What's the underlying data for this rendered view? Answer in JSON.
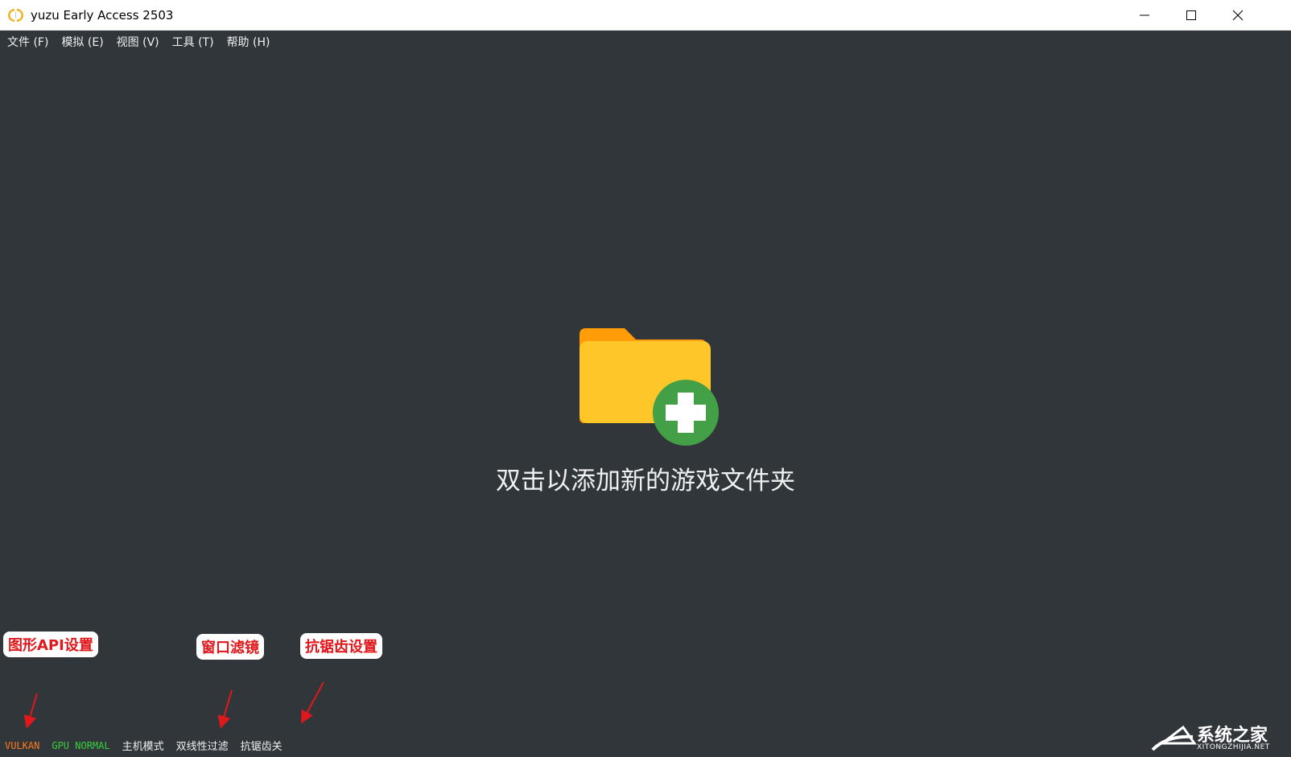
{
  "window": {
    "title": "yuzu Early Access 2503"
  },
  "menu": [
    {
      "label": "文件 (F)"
    },
    {
      "label": "模拟 (E)"
    },
    {
      "label": "视图 (V)"
    },
    {
      "label": "工具 (T)"
    },
    {
      "label": "帮助 (H)"
    }
  ],
  "main": {
    "hint": "双击以添加新的游戏文件夹",
    "icon": "folder-add-icon"
  },
  "status": {
    "api": {
      "label": "VULKAN",
      "color": "#ff7a1a"
    },
    "gpu": {
      "label": "GPU NORMAL",
      "color": "#38d13a"
    },
    "mode": {
      "label": "主机模式"
    },
    "filter": {
      "label": "双线性过滤"
    },
    "aa": {
      "label": "抗锯齿关"
    }
  },
  "annotations": {
    "api": "图形API设置",
    "filter": "窗口滤镜",
    "aa": "抗锯齿设置"
  },
  "watermark": {
    "title": "系统之家",
    "sub": "XITONGZHIJIA.NET"
  },
  "colors": {
    "background": "#31363b",
    "text": "#eff0f1",
    "annotation": "#e0181c"
  }
}
